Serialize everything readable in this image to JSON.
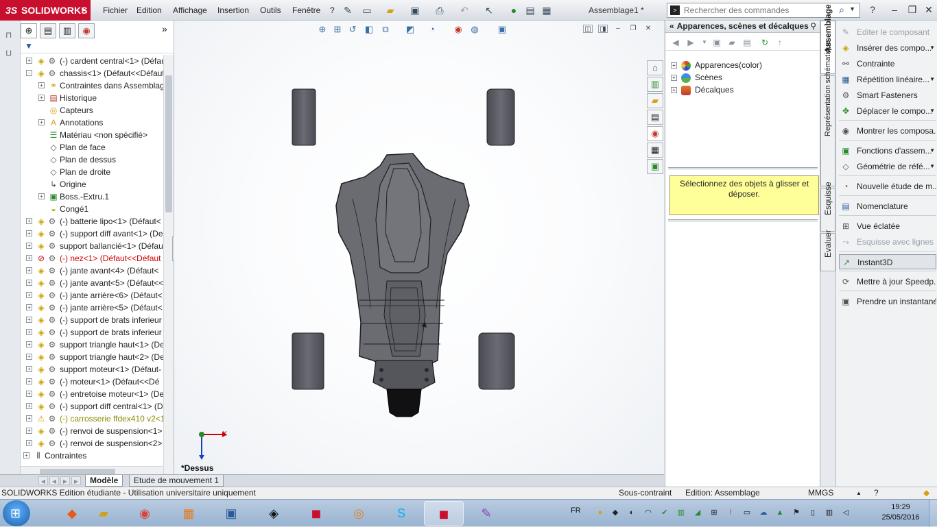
{
  "app": {
    "brand": "SOLIDWORKS",
    "brand_prefix": "3S",
    "document_title": "Assemblage1 *",
    "brand_color": "#c8102e"
  },
  "menu": [
    "Fichier",
    "Edition",
    "Affichage",
    "Insertion",
    "Outils",
    "Fenêtre",
    "?"
  ],
  "search": {
    "placeholder": "Rechercher des commandes"
  },
  "feature_tree": {
    "rows": [
      {
        "label": "(-) cardent central<1> (Défaut",
        "indent": 0,
        "exp": "+",
        "icon": "part-icon",
        "color": "normal"
      },
      {
        "label": "chassis<1> (Défaut<<Défaut",
        "indent": 0,
        "exp": "−",
        "icon": "part-icon",
        "color": "normal"
      },
      {
        "label": "Contraintes dans Assemblag",
        "indent": 1,
        "exp": "+",
        "icon": "mates-folder-icon",
        "color": "normal"
      },
      {
        "label": "Historique",
        "indent": 1,
        "exp": "+",
        "icon": "history-icon",
        "color": "normal"
      },
      {
        "label": "Capteurs",
        "indent": 1,
        "exp": "",
        "icon": "sensor-icon",
        "color": "normal"
      },
      {
        "label": "Annotations",
        "indent": 1,
        "exp": "+",
        "icon": "annotation-icon",
        "color": "normal"
      },
      {
        "label": "Matériau <non spécifié>",
        "indent": 1,
        "exp": "",
        "icon": "material-icon",
        "color": "normal"
      },
      {
        "label": "Plan de face",
        "indent": 1,
        "exp": "",
        "icon": "plane-icon",
        "color": "normal"
      },
      {
        "label": "Plan de dessus",
        "indent": 1,
        "exp": "",
        "icon": "plane-icon",
        "color": "normal"
      },
      {
        "label": "Plan de droite",
        "indent": 1,
        "exp": "",
        "icon": "plane-icon",
        "color": "normal"
      },
      {
        "label": "Origine",
        "indent": 1,
        "exp": "",
        "icon": "origin-icon",
        "color": "normal"
      },
      {
        "label": "Boss.-Extru.1",
        "indent": 1,
        "exp": "+",
        "icon": "extrude-icon",
        "color": "normal"
      },
      {
        "label": "Congé1",
        "indent": 1,
        "exp": "",
        "icon": "fillet-icon",
        "color": "normal"
      },
      {
        "label": "(-) batterie lipo<1> (Défaut<",
        "indent": 0,
        "exp": "+",
        "icon": "part-icon",
        "color": "normal"
      },
      {
        "label": "(-) support diff avant<1> (De",
        "indent": 0,
        "exp": "+",
        "icon": "part-icon",
        "color": "normal"
      },
      {
        "label": "support ballancié<1> (Défau",
        "indent": 0,
        "exp": "+",
        "icon": "part-icon",
        "color": "normal"
      },
      {
        "label": "(-) nez<1> (Défaut<<Défaut",
        "indent": 0,
        "exp": "+",
        "icon": "error-icon",
        "color": "red"
      },
      {
        "label": "(-) jante avant<4> (Défaut<",
        "indent": 0,
        "exp": "+",
        "icon": "part-icon",
        "color": "normal"
      },
      {
        "label": "(-) jante avant<5> (Défaut<<",
        "indent": 0,
        "exp": "+",
        "icon": "part-icon",
        "color": "normal"
      },
      {
        "label": "(-) jante arrière<6> (Défaut<",
        "indent": 0,
        "exp": "+",
        "icon": "part-icon",
        "color": "normal"
      },
      {
        "label": "(-) jante arrière<5> (Défaut<",
        "indent": 0,
        "exp": "+",
        "icon": "part-icon",
        "color": "normal"
      },
      {
        "label": "(-) support de brats inferieur",
        "indent": 0,
        "exp": "+",
        "icon": "part-icon",
        "color": "normal"
      },
      {
        "label": "(-) support de brats inferieur",
        "indent": 0,
        "exp": "+",
        "icon": "part-icon",
        "color": "normal"
      },
      {
        "label": "support triangle haut<1> (De",
        "indent": 0,
        "exp": "+",
        "icon": "part-icon",
        "color": "normal"
      },
      {
        "label": "support triangle haut<2> (De",
        "indent": 0,
        "exp": "+",
        "icon": "part-icon",
        "color": "normal"
      },
      {
        "label": "support moteur<1> (Défaut-",
        "indent": 0,
        "exp": "+",
        "icon": "part-icon",
        "color": "normal"
      },
      {
        "label": "(-) moteur<1> (Défaut<<Dé",
        "indent": 0,
        "exp": "+",
        "icon": "part-icon",
        "color": "normal"
      },
      {
        "label": "(-) entretoise moteur<1> (De",
        "indent": 0,
        "exp": "+",
        "icon": "part-icon",
        "color": "normal"
      },
      {
        "label": "(-) support diff central<1> (D",
        "indent": 0,
        "exp": "+",
        "icon": "part-icon",
        "color": "normal"
      },
      {
        "label": "(-) carrosserie ffdex410 v2<1>",
        "indent": 0,
        "exp": "+",
        "icon": "warning-icon",
        "color": "olive"
      },
      {
        "label": "(-) renvoi de suspension<1>",
        "indent": 0,
        "exp": "+",
        "icon": "part-icon",
        "color": "normal"
      },
      {
        "label": "(-) renvoi de suspension<2>",
        "indent": 0,
        "exp": "+",
        "icon": "part-icon",
        "color": "normal"
      },
      {
        "label": "Contraintes",
        "indent": -1,
        "exp": "+",
        "icon": "mates-icon",
        "color": "normal"
      }
    ]
  },
  "graphics": {
    "view_label": "*Dessus",
    "triad_x": "X",
    "bottom_tabs": [
      "Modèle",
      "Etude de mouvement 1"
    ]
  },
  "appearances": {
    "title": "Apparences, scènes et décalques",
    "items": [
      {
        "label": "Apparences(color)",
        "icon": "appearance-icon"
      },
      {
        "label": "Scènes",
        "icon": "scene-icon"
      },
      {
        "label": "Décalques",
        "icon": "decal-icon"
      }
    ],
    "hint": "Sélectionnez des objets à glisser et déposer."
  },
  "vertical_tabs": [
    "Assemblage",
    "Représentation schématique",
    "Esquisse",
    "Evaluer"
  ],
  "commands": [
    {
      "label": "Editer le composant",
      "icon": "edit-component-icon",
      "disabled": true,
      "arrow": false
    },
    {
      "label": "Insérer des compo...",
      "icon": "insert-component-icon",
      "disabled": false,
      "arrow": true
    },
    {
      "label": "Contrainte",
      "icon": "mate-icon",
      "disabled": false,
      "arrow": false
    },
    {
      "label": "Répétition linéaire...",
      "icon": "linear-pattern-icon",
      "disabled": false,
      "arrow": true
    },
    {
      "label": "Smart Fasteners",
      "icon": "fastener-icon",
      "disabled": false,
      "arrow": false
    },
    {
      "label": "Déplacer le compo...",
      "icon": "move-component-icon",
      "disabled": false,
      "arrow": true
    },
    {
      "label": "Montrer les composa...",
      "icon": "show-components-icon",
      "disabled": false,
      "arrow": false
    },
    {
      "label": "Fonctions d'assem...",
      "icon": "assembly-features-icon",
      "disabled": false,
      "arrow": true
    },
    {
      "label": "Géométrie de réfé...",
      "icon": "reference-geometry-icon",
      "disabled": false,
      "arrow": true
    },
    {
      "label": "Nouvelle étude de m...",
      "icon": "motion-study-icon",
      "disabled": false,
      "arrow": false
    },
    {
      "label": "Nomenclature",
      "icon": "bom-icon",
      "disabled": false,
      "arrow": false
    },
    {
      "label": "Vue éclatée",
      "icon": "exploded-view-icon",
      "disabled": false,
      "arrow": false
    },
    {
      "label": "Esquisse avec lignes ...",
      "icon": "explode-line-icon",
      "disabled": true,
      "arrow": false
    },
    {
      "label": "Instant3D",
      "icon": "instant3d-icon",
      "disabled": false,
      "arrow": false,
      "selected": true
    },
    {
      "label": "Mettre à jour Speedp...",
      "icon": "speedpak-icon",
      "disabled": false,
      "arrow": false
    },
    {
      "label": "Prendre un instantané",
      "icon": "snapshot-icon",
      "disabled": false,
      "arrow": false
    }
  ],
  "status": {
    "left": "SOLIDWORKS Edition étudiante - Utilisation universitaire uniquement",
    "constraint": "Sous-contraint",
    "mode": "Edition: Assemblage",
    "units": "MMGS"
  },
  "taskbar": {
    "language": "FR",
    "time": "19:29",
    "date": "25/05/2016",
    "apps": [
      {
        "name": "start-orb"
      },
      {
        "icon": "orange-app-icon"
      },
      {
        "icon": "file-explorer-icon"
      },
      {
        "icon": "chrome-icon"
      },
      {
        "icon": "apps-grid-icon"
      },
      {
        "icon": "control-panel-icon"
      },
      {
        "icon": "solidworks-icon"
      },
      {
        "icon": "solidworks-2015-icon",
        "badge": "2015"
      },
      {
        "icon": "blender-icon"
      },
      {
        "icon": "skype-icon"
      },
      {
        "icon": "solidworks-2015-active-icon",
        "badge": "2015"
      },
      {
        "icon": "paint-icon"
      }
    ]
  }
}
